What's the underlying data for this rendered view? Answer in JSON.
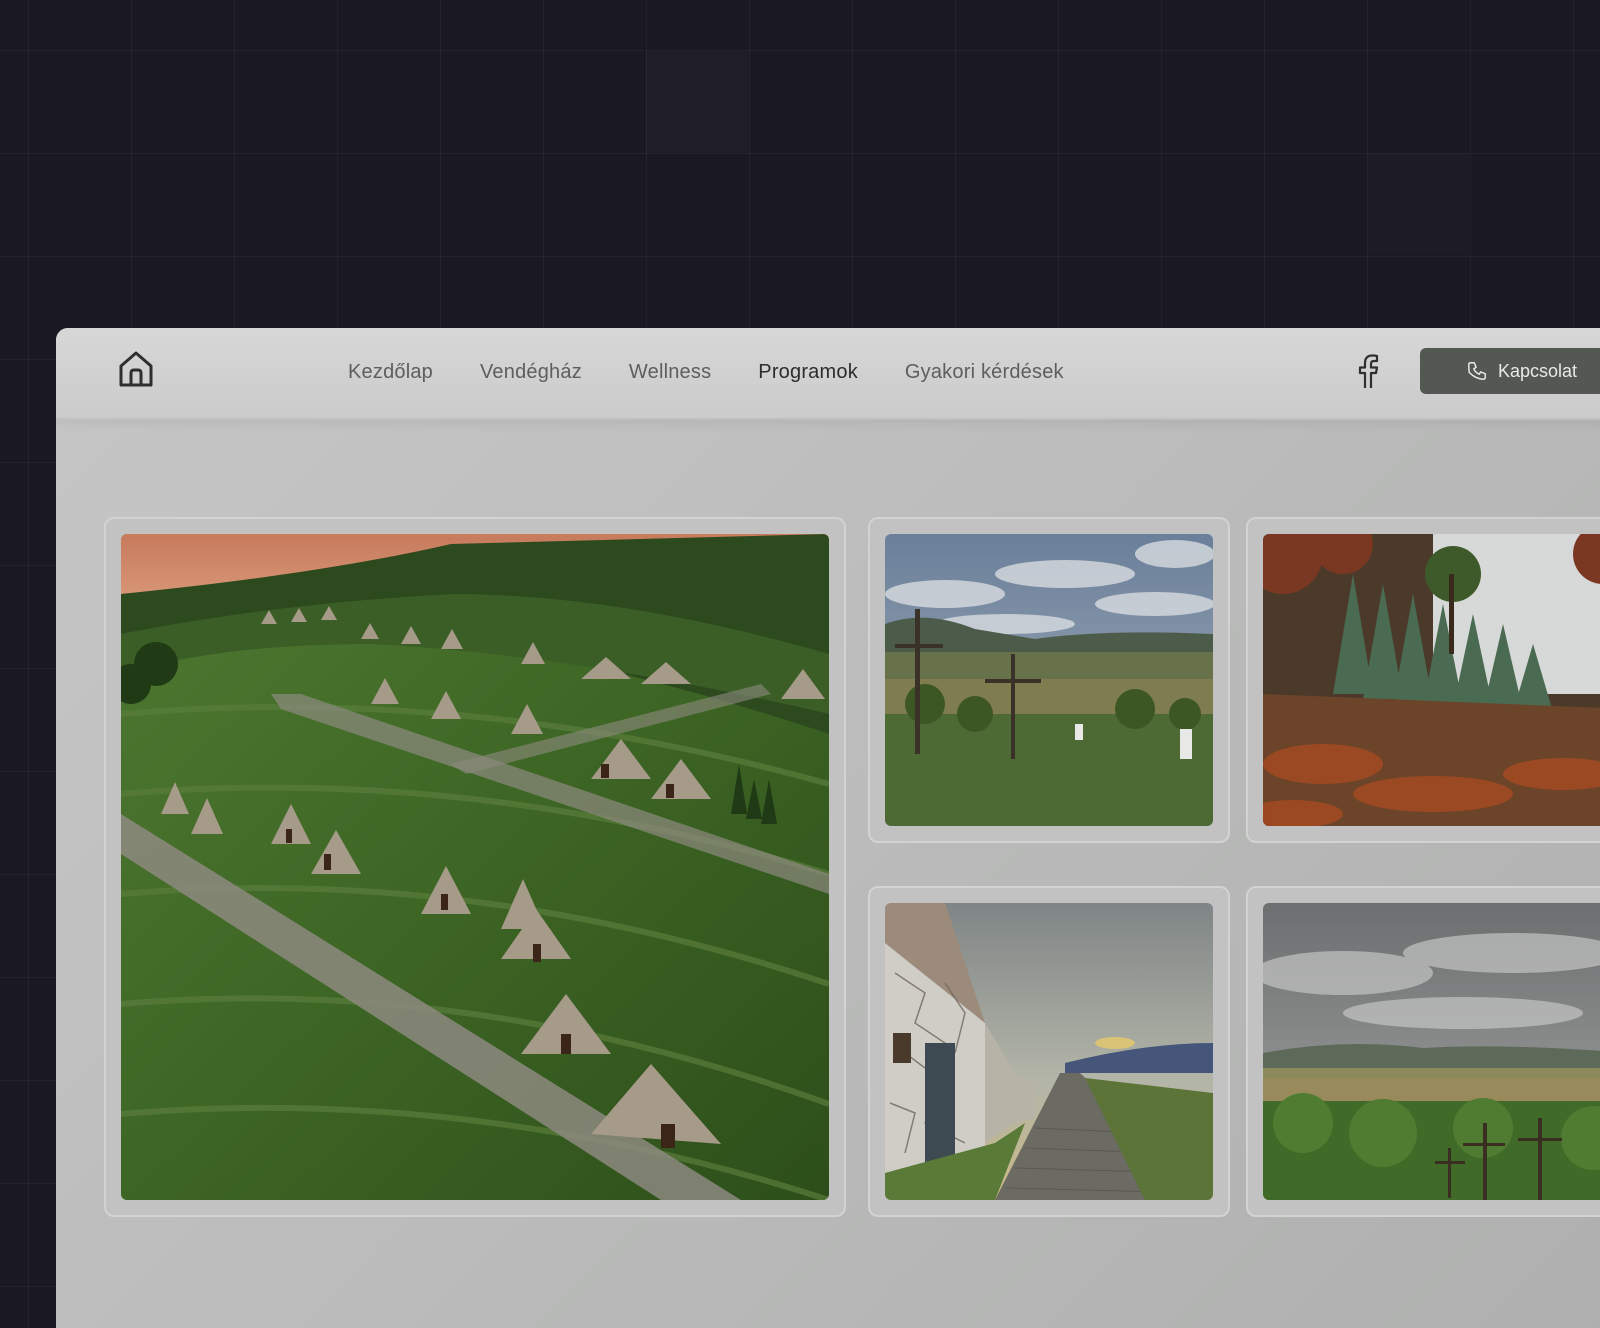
{
  "header": {
    "nav": [
      {
        "label": "Kezdőlap",
        "active": false
      },
      {
        "label": "Vendégház",
        "active": false
      },
      {
        "label": "Wellness",
        "active": false
      },
      {
        "label": "Programok",
        "active": true
      },
      {
        "label": "Gyakori kérdések",
        "active": false
      }
    ],
    "contact_label": "Kapcsolat",
    "icons": {
      "home": "home-icon",
      "facebook": "facebook-icon",
      "phone": "phone-icon"
    }
  },
  "gallery": [
    {
      "subject": "wine-cellar-hillside"
    },
    {
      "subject": "crosses-valley-view"
    },
    {
      "subject": "autumn-cellar-row"
    },
    {
      "subject": "stone-cellar-lane"
    },
    {
      "subject": "cloudy-valley-crosses"
    }
  ],
  "colors": {
    "page_background": "#1a1820",
    "site_background": "#bdbdbd",
    "header_background": "#d0d0d0",
    "button_background": "#545853",
    "nav_text": "#5d5f5c",
    "nav_active_text": "#2c2d2b"
  }
}
